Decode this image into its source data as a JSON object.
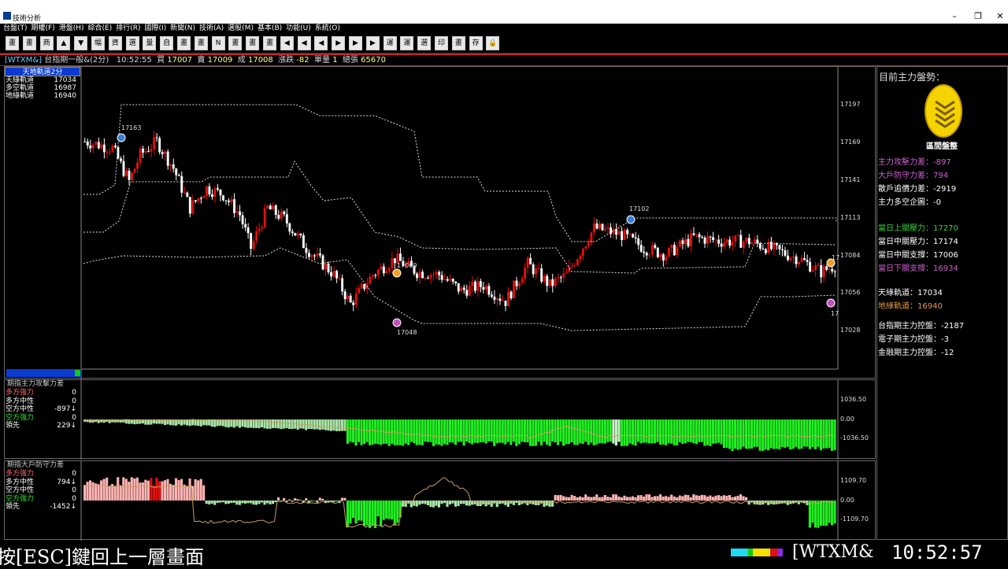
{
  "window": {
    "title": "技術分析",
    "min": "–",
    "max": "❐",
    "close": "✕"
  },
  "menu": [
    "台盤(T)",
    "期權(F)",
    "港盤(H)",
    "綜合(E)",
    "排行(R)",
    "國際(I)",
    "新聞(N)",
    "技術(A)",
    "選股(M)",
    "基本(B)",
    "功能(U)",
    "系統(O)"
  ],
  "toolbar": [
    "畫",
    "畫",
    "商",
    "▲",
    "▼",
    "幅",
    "資",
    "選",
    "量",
    "自",
    "畫",
    "畫",
    "N",
    "畫",
    "畫",
    "畫",
    "◀",
    "◀",
    "◀",
    "▶",
    "▶",
    "▶",
    "運",
    "運",
    "選",
    "印",
    "畫",
    "存",
    "🔒"
  ],
  "info": {
    "code": "[WTXM&]",
    "name": "台指期一般&(2分)",
    "time": "10:52:55",
    "buy_label": "買",
    "buy": "17007",
    "sell_label": "賣",
    "sell": "17009",
    "deal_label": "成",
    "deal": "17008",
    "change_label": "漲跌",
    "change": "-82",
    "vol_label": "單量",
    "vol": "1",
    "total_label": "總張",
    "total": "65670"
  },
  "main_legend": {
    "title": "天地軌道2分",
    "rows": [
      {
        "label": "天綠軌道",
        "value": "17034",
        "color": "#ffffff"
      },
      {
        "label": "多空軌道",
        "value": "16987",
        "color": "#ffffff"
      },
      {
        "label": "地綠軌道",
        "value": "16940",
        "color": "#ffffff"
      }
    ]
  },
  "main_yaxis": [
    "17197",
    "17169",
    "17141",
    "17113",
    "17084",
    "17056",
    "17028"
  ],
  "annotations": {
    "high1": "17163",
    "low1": "17048",
    "mid1": "17069",
    "high2": "17102",
    "edge1": "17",
    "edge2": "17"
  },
  "sub1": {
    "title": "期指主力攻擊力差",
    "rows": [
      {
        "label": "多方強力",
        "value": "0",
        "color": "#ff6a6a"
      },
      {
        "label": "多方中性",
        "value": "0",
        "color": "#ffffff"
      },
      {
        "label": "空方中性",
        "value": "-897↓",
        "color": "#ffffff"
      },
      {
        "label": "空方強力",
        "value": "0",
        "color": "#2ee02e"
      },
      {
        "label": "領先",
        "value": "229↓",
        "color": "#ffffff"
      }
    ],
    "yaxis": [
      "1036.50",
      "0.00",
      "-1036.50"
    ]
  },
  "sub2": {
    "title": "期指大戶防守力差",
    "rows": [
      {
        "label": "多方強力",
        "value": "0",
        "color": "#ff6a6a"
      },
      {
        "label": "多方中性",
        "value": "794↓",
        "color": "#ffffff"
      },
      {
        "label": "空方中性",
        "value": "0",
        "color": "#ffffff"
      },
      {
        "label": "空方強力",
        "value": "0",
        "color": "#2ee02e"
      },
      {
        "label": "領先",
        "value": "-1452↓",
        "color": "#ffffff"
      }
    ],
    "yaxis": [
      "1109.70",
      "0.00",
      "-1109.70"
    ]
  },
  "right": {
    "title": "目前主力盤勢：",
    "badge": "區間盤整",
    "lines": [
      {
        "text": "主力攻擊力差：-897",
        "color": "#d060d0"
      },
      {
        "text": "大戶防守力差：794",
        "color": "#d060d0"
      },
      {
        "text": "散戶追價力差：-2919",
        "color": "#ffffff"
      },
      {
        "text": "主力多空企圖：-0",
        "color": "#ffffff"
      },
      {
        "text": "當日上關壓力：17270",
        "color": "#3cd03c"
      },
      {
        "text": "當日中關壓力：17174",
        "color": "#ffffff"
      },
      {
        "text": "當日中關支撐：17006",
        "color": "#ffffff"
      },
      {
        "text": "當日下關支撐：16934",
        "color": "#d060d0"
      },
      {
        "text": "天綠軌道：17034",
        "color": "#ffffff"
      },
      {
        "text": "地綠軌道：16940",
        "color": "#e89a3a"
      },
      {
        "text": "台指期主力控盤：-2187",
        "color": "#ffffff"
      },
      {
        "text": "電子期主力控盤：-3",
        "color": "#ffffff"
      },
      {
        "text": "金融期主力控盤：-12",
        "color": "#ffffff"
      }
    ]
  },
  "status": {
    "msg": "按[ESC]鍵回上一層畫面",
    "code": "[WTXM&",
    "time": "10:52:57"
  },
  "colors": {
    "up": "#e01010",
    "down": "#ffffff",
    "panel_border": "#666666",
    "accent_green": "#22ee22",
    "accent_pink": "#ffb3b3"
  }
}
